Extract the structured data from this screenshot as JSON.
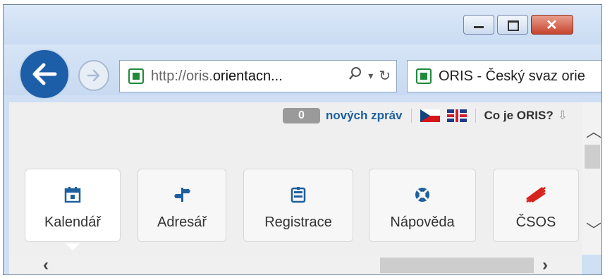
{
  "browser": {
    "address": {
      "url_scheme": "http://oris.",
      "url_host": "orientacn...",
      "search_icon": "search-icon",
      "dropdown_icon": "chevron-down-icon",
      "refresh_icon": "refresh-icon"
    },
    "tab": {
      "title": "ORIS - Český svaz orie"
    }
  },
  "page": {
    "messages": {
      "count": "0",
      "label": "nových zpráv"
    },
    "about": {
      "label": "Co je ORIS?",
      "arrow": "⇩"
    },
    "nav": [
      {
        "label": "Kalendář",
        "icon": "calendar-icon"
      },
      {
        "label": "Adresář",
        "icon": "signpost-icon"
      },
      {
        "label": "Registrace",
        "icon": "registration-icon"
      },
      {
        "label": "Nápověda",
        "icon": "lifebuoy-icon"
      },
      {
        "label": "ČSOS",
        "icon": "csos-logo-icon"
      }
    ]
  },
  "colors": {
    "back_button": "#1c5ea8",
    "link": "#1e5f9e",
    "badge": "#9a9a9a"
  }
}
